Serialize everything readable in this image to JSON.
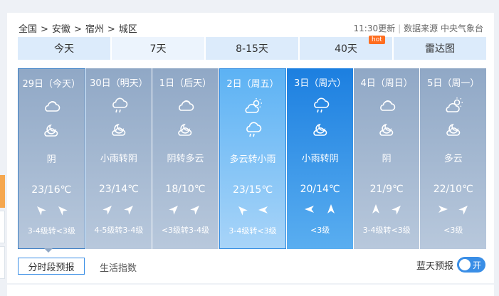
{
  "breadcrumb": [
    "全国",
    ">",
    "安徽",
    ">",
    "宿州",
    ">",
    "城区"
  ],
  "source": {
    "updated": "11:30更新",
    "divider": "|",
    "text": "数据来源 中央气象台"
  },
  "tabs": [
    {
      "label": "今天"
    },
    {
      "label": "7天"
    },
    {
      "label": "8-15天"
    },
    {
      "label": "40天",
      "badge": "hot"
    },
    {
      "label": "雷达图"
    }
  ],
  "days": [
    {
      "date": "29日（今天）",
      "icon_day": "cloudy-icon",
      "icon_night": "moon-cloud-icon",
      "desc": "阴",
      "temp": "23/16℃",
      "wind_dirs": [
        "northwest",
        "northwest"
      ],
      "wind": "3-4级转<3级"
    },
    {
      "date": "30日（明天）",
      "icon_day": "rain-icon",
      "icon_night": "moon-cloud-icon",
      "desc": "小雨转阴",
      "temp": "23/14℃",
      "wind_dirs": [
        "northeast",
        "northeast"
      ],
      "wind": "4-5级转3-4级"
    },
    {
      "date": "1日（后天）",
      "icon_day": "cloudy-icon",
      "icon_night": "moon-cloud-icon",
      "desc": "阴转多云",
      "temp": "18/10℃",
      "wind_dirs": [
        "northeast",
        "northeast"
      ],
      "wind": "<3级转3-4级"
    },
    {
      "date": "2日（周五）",
      "icon_day": "sun-cloud-icon",
      "icon_night": "rain-icon",
      "desc": "多云转小雨",
      "temp": "23/15℃",
      "wind_dirs": [
        "northwest",
        "west"
      ],
      "wind": "3-4级转<3级"
    },
    {
      "date": "3日（周六）",
      "icon_day": "rain-icon",
      "icon_night": "moon-cloud-icon",
      "desc": "小雨转阴",
      "temp": "20/14℃",
      "wind_dirs": [
        "west",
        "north"
      ],
      "wind": "<3级"
    },
    {
      "date": "4日（周日）",
      "icon_day": "cloudy-icon",
      "icon_night": "moon-cloud-icon",
      "desc": "阴",
      "temp": "21/9℃",
      "wind_dirs": [
        "north",
        "northeast"
      ],
      "wind": "3-4级转<3级"
    },
    {
      "date": "5日（周一）",
      "icon_day": "sun-cloud-icon",
      "icon_night": "moon-cloud-icon",
      "desc": "多云",
      "temp": "22/10℃",
      "wind_dirs": [
        "east",
        "northeast"
      ],
      "wind": "<3级"
    }
  ],
  "footer": {
    "hourly_button": "分时段预报",
    "life_index": "生活指数",
    "blue_sky_label": "蓝天预报",
    "toggle_label": "开"
  }
}
